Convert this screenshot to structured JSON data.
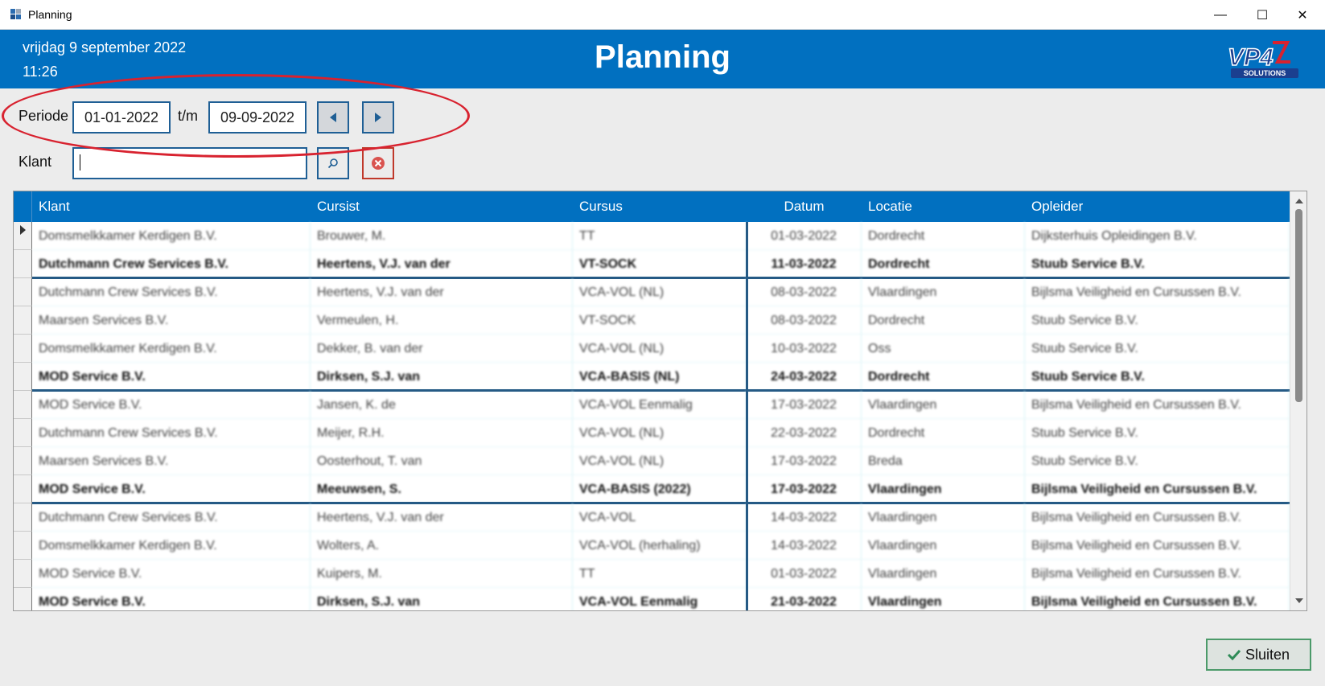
{
  "window": {
    "title": "Planning",
    "minimize": "—",
    "maximize": "☐",
    "close": "✕"
  },
  "header": {
    "date": "vrijdag 9 september 2022",
    "time": "11:26",
    "title": "Planning",
    "logo_alt": "VP4 SOLUTIONS"
  },
  "filters": {
    "periode_label": "Periode",
    "from": "01-01-2022",
    "to_label": "t/m",
    "to": "09-09-2022",
    "klant_label": "Klant",
    "klant_value": ""
  },
  "table": {
    "columns": [
      "Klant",
      "Cursist",
      "Cursus",
      "Datum",
      "Locatie",
      "Opleider"
    ],
    "rows": [
      [
        "Domsmelkkamer Kerdigen B.V.",
        "Brouwer, M.",
        "TT",
        "01-03-2022",
        "Dordrecht",
        "Dijksterhuis Opleidingen B.V."
      ],
      [
        "Dutchmann Crew Services B.V.",
        "Heertens, V.J. van der",
        "VT-SOCK",
        "11-03-2022",
        "Dordrecht",
        "Stuub Service B.V."
      ],
      [
        "Dutchmann Crew Services B.V.",
        "Heertens, V.J. van der",
        "VCA-VOL (NL)",
        "08-03-2022",
        "Vlaardingen",
        "Bijlsma Veiligheid en Cursussen B.V."
      ],
      [
        "Maarsen Services B.V.",
        "Vermeulen, H.",
        "VT-SOCK",
        "08-03-2022",
        "Dordrecht",
        "Stuub Service B.V."
      ],
      [
        "Domsmelkkamer Kerdigen B.V.",
        "Dekker, B. van der",
        "VCA-VOL (NL)",
        "10-03-2022",
        "Oss",
        "Stuub Service B.V."
      ],
      [
        "MOD Service B.V.",
        "Dirksen, S.J. van",
        "VCA-BASIS (NL)",
        "24-03-2022",
        "Dordrecht",
        "Stuub Service B.V."
      ],
      [
        "MOD Service B.V.",
        "Jansen, K. de",
        "VCA-VOL Eenmalig",
        "17-03-2022",
        "Vlaardingen",
        "Bijlsma Veiligheid en Cursussen B.V."
      ],
      [
        "Dutchmann Crew Services B.V.",
        "Meijer, R.H.",
        "VCA-VOL (NL)",
        "22-03-2022",
        "Dordrecht",
        "Stuub Service B.V."
      ],
      [
        "Maarsen Services B.V.",
        "Oosterhout, T. van",
        "VCA-VOL (NL)",
        "17-03-2022",
        "Breda",
        "Stuub Service B.V."
      ],
      [
        "MOD Service B.V.",
        "Meeuwsen, S.",
        "VCA-BASIS (2022)",
        "17-03-2022",
        "Vlaardingen",
        "Bijlsma Veiligheid en Cursussen B.V."
      ],
      [
        "Dutchmann Crew Services B.V.",
        "Heertens, V.J. van der",
        "VCA-VOL",
        "14-03-2022",
        "Vlaardingen",
        "Bijlsma Veiligheid en Cursussen B.V."
      ],
      [
        "Domsmelkkamer Kerdigen B.V.",
        "Wolters, A.",
        "VCA-VOL (herhaling)",
        "14-03-2022",
        "Vlaardingen",
        "Bijlsma Veiligheid en Cursussen B.V."
      ],
      [
        "MOD Service B.V.",
        "Kuipers, M.",
        "TT",
        "01-03-2022",
        "Vlaardingen",
        "Bijlsma Veiligheid en Cursussen B.V."
      ],
      [
        "MOD Service B.V.",
        "Dirksen, S.J. van",
        "VCA-VOL Eenmalig",
        "21-03-2022",
        "Vlaardingen",
        "Bijlsma Veiligheid en Cursussen B.V."
      ]
    ]
  },
  "footer": {
    "close_label": "Sluiten"
  },
  "colors": {
    "header_blue": "#0170c0",
    "border_blue": "#1f5f95",
    "annotation_red": "#d8222f",
    "close_green": "#4c9a6a"
  }
}
